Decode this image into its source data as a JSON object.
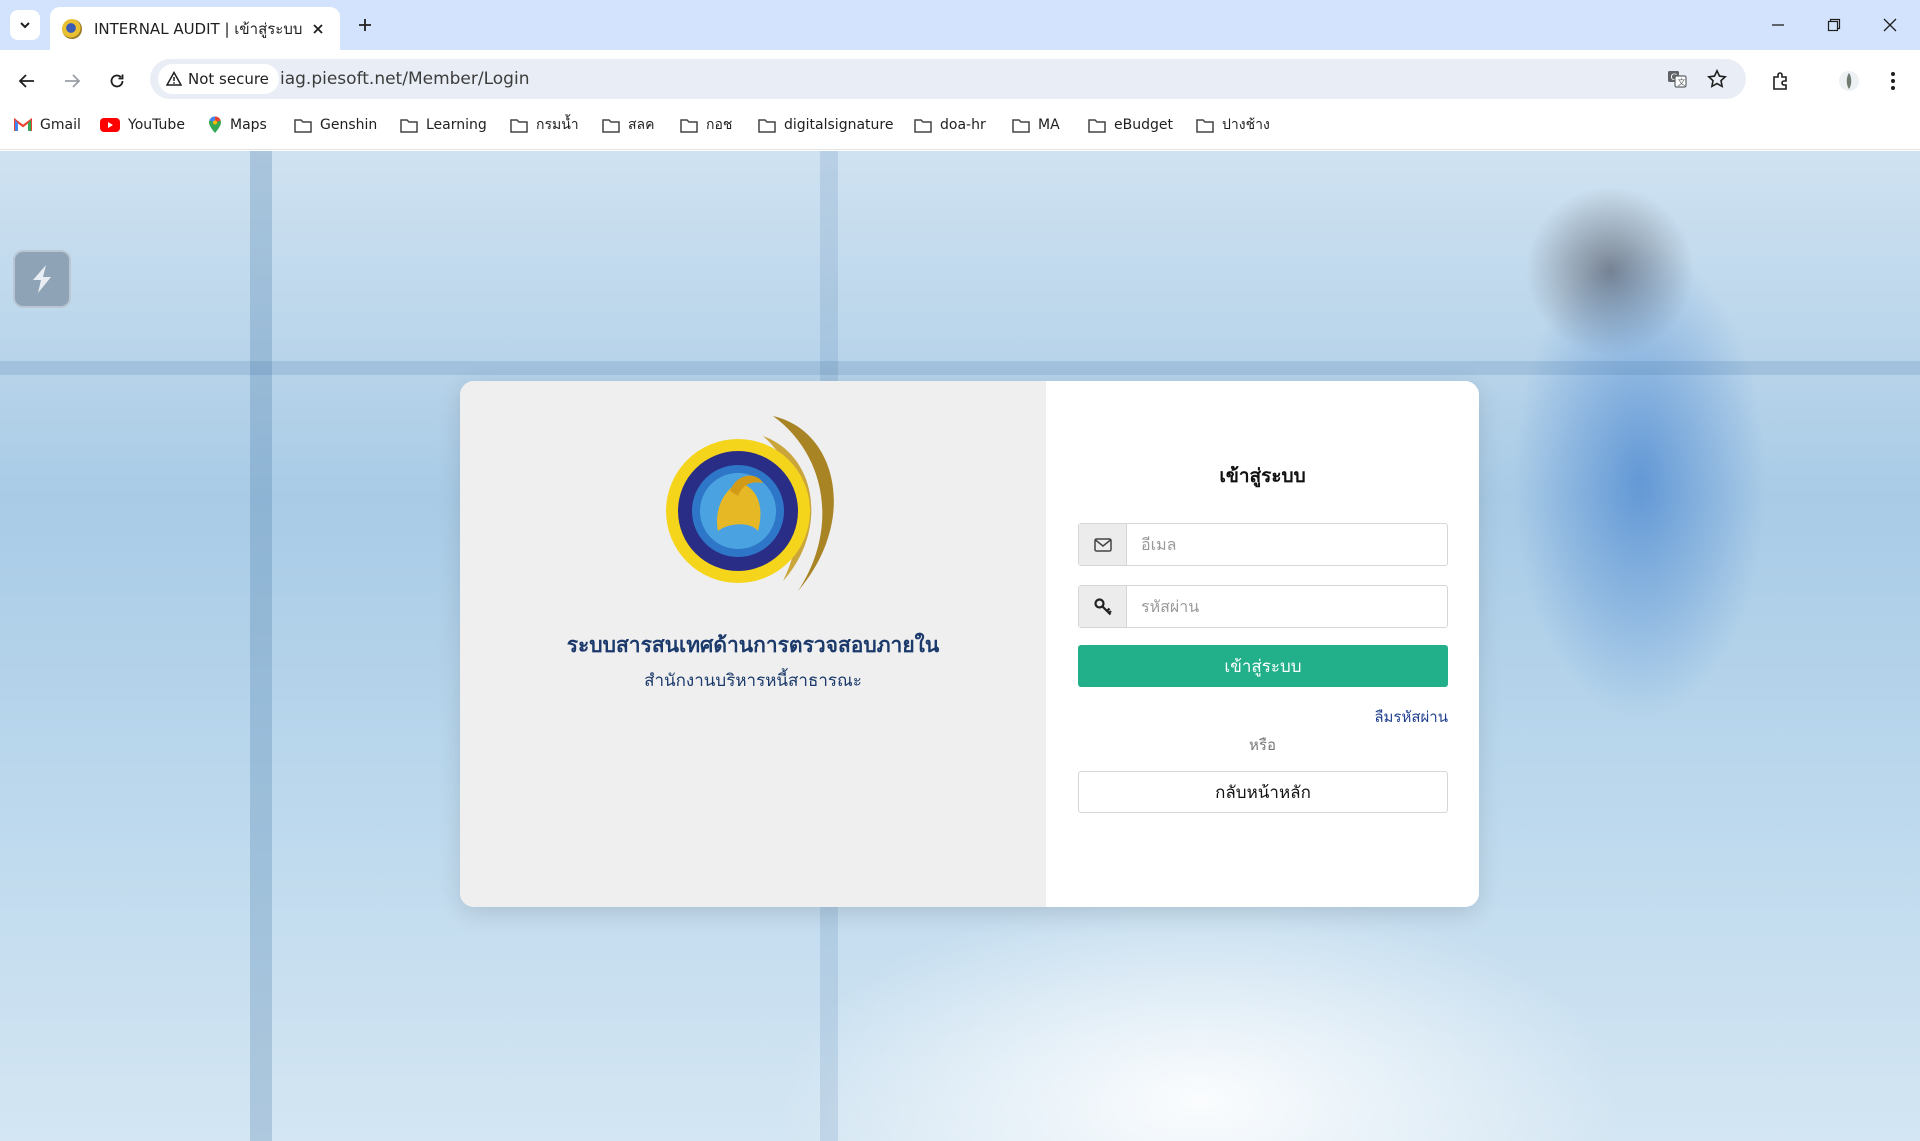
{
  "browser": {
    "tab_title": "INTERNAL AUDIT | เข้าสู่ระบบ",
    "security_label": "Not secure",
    "url": "iag.piesoft.net/Member/Login",
    "bookmarks": [
      {
        "label": "Gmail",
        "icon": "gmail-icon"
      },
      {
        "label": "YouTube",
        "icon": "youtube-icon"
      },
      {
        "label": "Maps",
        "icon": "maps-icon"
      },
      {
        "label": "Genshin",
        "icon": "folder-icon"
      },
      {
        "label": "Learning",
        "icon": "folder-icon"
      },
      {
        "label": "กรมน้ำ",
        "icon": "folder-icon"
      },
      {
        "label": "สลค",
        "icon": "folder-icon"
      },
      {
        "label": "กอช",
        "icon": "folder-icon"
      },
      {
        "label": "digitalsignature",
        "icon": "folder-icon"
      },
      {
        "label": "doa-hr",
        "icon": "folder-icon"
      },
      {
        "label": "MA",
        "icon": "folder-icon"
      },
      {
        "label": "eBudget",
        "icon": "folder-icon"
      },
      {
        "label": "ปางช้าง",
        "icon": "folder-icon"
      }
    ]
  },
  "login": {
    "system_title": "ระบบสารสนเทศด้านการตรวจสอบภายใน",
    "organization": "สำนักงานบริหารหนี้สาธารณะ",
    "heading": "เข้าสู่ระบบ",
    "email_placeholder": "อีเมล",
    "password_placeholder": "รหัสผ่าน",
    "submit_label": "เข้าสู่ระบบ",
    "forgot_label": "ลืมรหัสผ่าน",
    "or_label": "หรือ",
    "home_label": "กลับหน้าหลัก"
  },
  "colors": {
    "primary_button": "#21b08a",
    "title_text": "#1b3a6b",
    "tabstrip": "#d3e3fd"
  }
}
